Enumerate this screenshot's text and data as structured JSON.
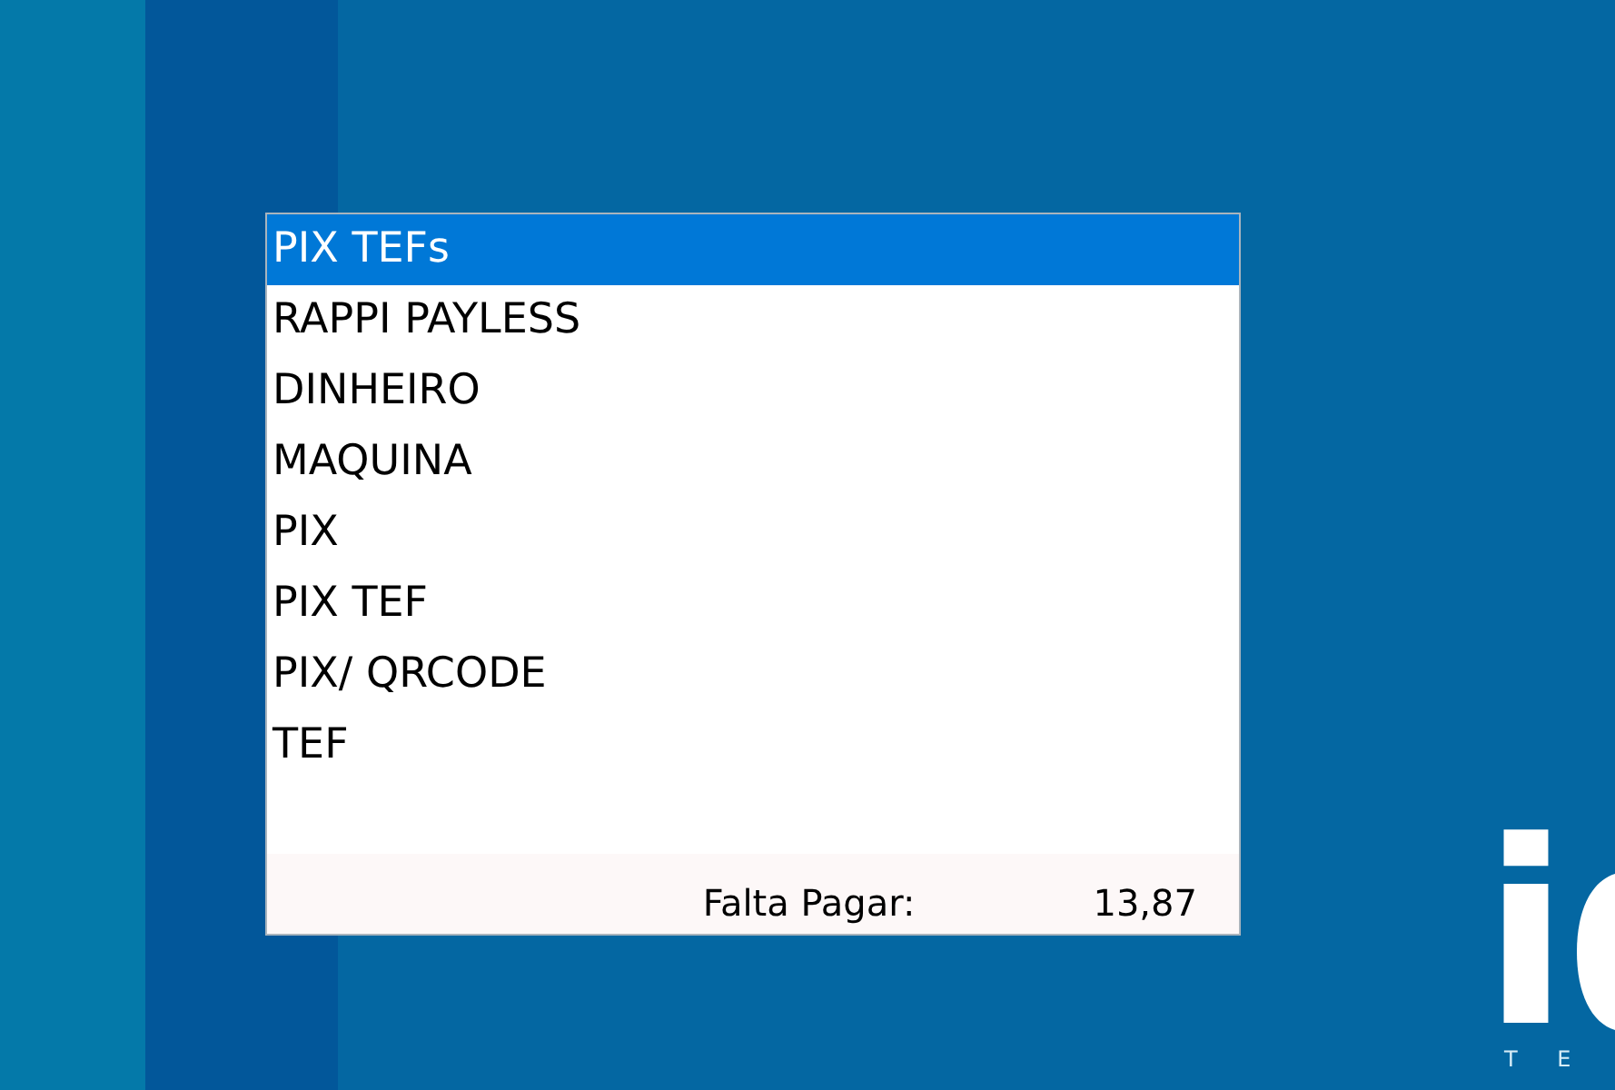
{
  "payment_methods": [
    {
      "label": "PIX TEFs",
      "selected": true
    },
    {
      "label": "RAPPI PAYLESS",
      "selected": false
    },
    {
      "label": "DINHEIRO",
      "selected": false
    },
    {
      "label": "MAQUINA",
      "selected": false
    },
    {
      "label": "PIX",
      "selected": false
    },
    {
      "label": "PIX TEF",
      "selected": false
    },
    {
      "label": "PIX/ QRCODE",
      "selected": false
    },
    {
      "label": "TEF",
      "selected": false
    }
  ],
  "summary": {
    "label": "Falta Pagar:",
    "value": "13,87"
  },
  "logo": {
    "mark": "i",
    "tagline": "T E"
  }
}
